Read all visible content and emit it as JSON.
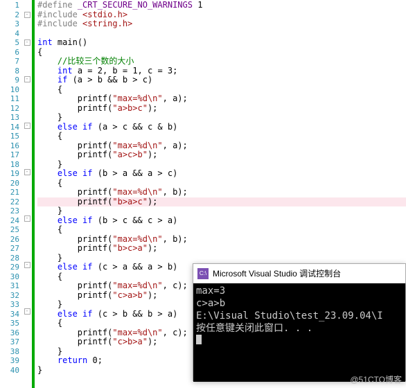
{
  "lines": [
    {
      "n": 1,
      "fold": "",
      "html": "<span class='kw-def'>#define</span> <span class='kw-mac'>_CRT_SECURE_NO_WARNINGS</span> 1"
    },
    {
      "n": 2,
      "fold": "⊟",
      "html": "<span class='kw-def'>#include</span> <span class='inc'>&lt;stdio.h&gt;</span>"
    },
    {
      "n": 3,
      "fold": "",
      "html": "<span class='kw-def'>#include</span> <span class='inc'>&lt;string.h&gt;</span>"
    },
    {
      "n": 4,
      "fold": "",
      "html": ""
    },
    {
      "n": 5,
      "fold": "⊟",
      "html": "<span class='kw'>int</span> <span class='id'>main</span>()"
    },
    {
      "n": 6,
      "fold": "",
      "html": "{"
    },
    {
      "n": 7,
      "fold": "",
      "html": "    <span class='cmt'>//比较三个数的大小</span>"
    },
    {
      "n": 8,
      "fold": "",
      "html": "    <span class='kw'>int</span> a <span class='id'>=</span> 2, b <span class='id'>=</span> 1, c <span class='id'>=</span> 3;"
    },
    {
      "n": 9,
      "fold": "⊟",
      "html": "    <span class='kw'>if</span> (a &gt; b &amp;&amp; b &gt; c)"
    },
    {
      "n": 10,
      "fold": "",
      "html": "    {"
    },
    {
      "n": 11,
      "fold": "",
      "html": "        printf(<span class='str'>\"max=%d\\n\"</span>, a);"
    },
    {
      "n": 12,
      "fold": "",
      "html": "        printf(<span class='str'>\"a&gt;b&gt;c\"</span>);"
    },
    {
      "n": 13,
      "fold": "",
      "html": "    }"
    },
    {
      "n": 14,
      "fold": "⊟",
      "html": "    <span class='kw'>else</span> <span class='kw'>if</span> (a &gt; c &amp;&amp; c &amp; b)"
    },
    {
      "n": 15,
      "fold": "",
      "html": "    {"
    },
    {
      "n": 16,
      "fold": "",
      "html": "        printf(<span class='str'>\"max=%d\\n\"</span>, a);"
    },
    {
      "n": 17,
      "fold": "",
      "html": "        printf(<span class='str'>\"a&gt;c&gt;b\"</span>);"
    },
    {
      "n": 18,
      "fold": "",
      "html": "    }"
    },
    {
      "n": 19,
      "fold": "⊟",
      "html": "    <span class='kw'>else</span> <span class='kw'>if</span> (b &gt; a &amp;&amp; a &gt; c)"
    },
    {
      "n": 20,
      "fold": "",
      "html": "    {"
    },
    {
      "n": 21,
      "fold": "",
      "html": "        printf(<span class='str'>\"max=%d\\n\"</span>, b);"
    },
    {
      "n": 22,
      "fold": "",
      "html": "        printf(<span class='str'>\"b&gt;a&gt;c\"</span>);",
      "pink": true
    },
    {
      "n": 23,
      "fold": "",
      "html": "    }"
    },
    {
      "n": 24,
      "fold": "⊟",
      "html": "    <span class='kw'>else</span> <span class='kw'>if</span> (b &gt; c &amp;&amp; c &gt; a)"
    },
    {
      "n": 25,
      "fold": "",
      "html": "    {"
    },
    {
      "n": 26,
      "fold": "",
      "html": "        printf(<span class='str'>\"max=%d\\n\"</span>, b);"
    },
    {
      "n": 27,
      "fold": "",
      "html": "        printf(<span class='str'>\"b&gt;c&gt;a\"</span>);"
    },
    {
      "n": 28,
      "fold": "",
      "html": "    }"
    },
    {
      "n": 29,
      "fold": "⊟",
      "html": "    <span class='kw'>else</span> <span class='kw'>if</span> (c &gt; a &amp;&amp; a &gt; b)"
    },
    {
      "n": 30,
      "fold": "",
      "html": "    {"
    },
    {
      "n": 31,
      "fold": "",
      "html": "        printf(<span class='str'>\"max=%d\\n\"</span>, c);"
    },
    {
      "n": 32,
      "fold": "",
      "html": "        printf(<span class='str'>\"c&gt;a&gt;b\"</span>);"
    },
    {
      "n": 33,
      "fold": "",
      "html": "    }"
    },
    {
      "n": 34,
      "fold": "⊟",
      "html": "    <span class='kw'>else</span> <span class='kw'>if</span> (c &gt; b &amp;&amp; b &gt; a)"
    },
    {
      "n": 35,
      "fold": "",
      "html": "    {"
    },
    {
      "n": 36,
      "fold": "",
      "html": "        printf(<span class='str'>\"max=%d\\n\"</span>, c);"
    },
    {
      "n": 37,
      "fold": "",
      "html": "        printf(<span class='str'>\"c&gt;b&gt;a\"</span>);"
    },
    {
      "n": 38,
      "fold": "",
      "html": "    }"
    },
    {
      "n": 39,
      "fold": "",
      "html": "    <span class='kw'>return</span> 0;"
    },
    {
      "n": 40,
      "fold": "",
      "html": "}"
    }
  ],
  "console": {
    "icon_text": "C:\\",
    "title": "Microsoft Visual Studio 调试控制台",
    "out1": "max=3",
    "out2": "c>a>b",
    "out3": "E:\\Visual Studio\\test_23.09.04\\I",
    "out4": "按任意键关闭此窗口. . ."
  },
  "watermark": "@51CTO博客"
}
